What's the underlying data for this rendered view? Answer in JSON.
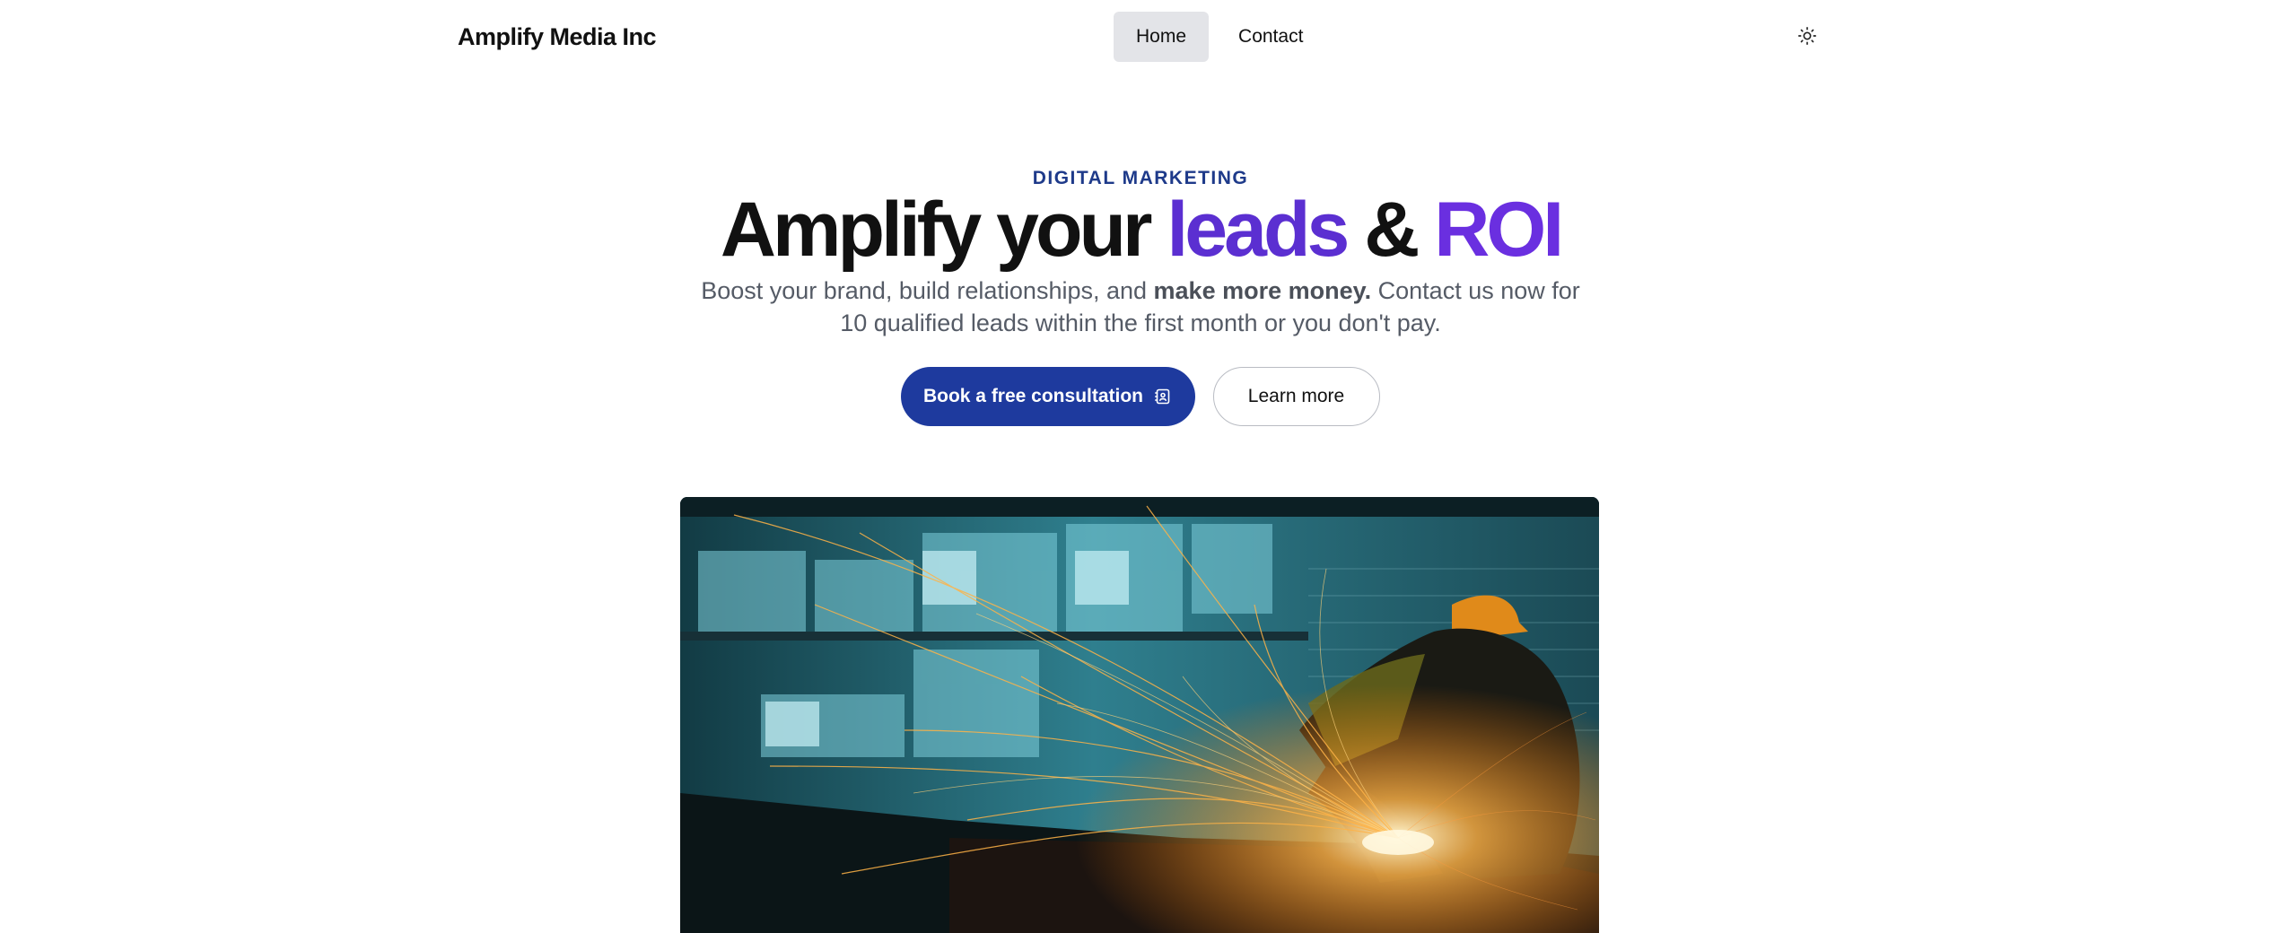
{
  "header": {
    "brand": "Amplify Media Inc",
    "nav": [
      {
        "label": "Home",
        "active": true
      },
      {
        "label": "Contact",
        "active": false
      }
    ],
    "theme_toggle_icon": "sun-icon"
  },
  "hero": {
    "eyebrow": "DIGITAL MARKETING",
    "headline": {
      "part1": "Amplify your ",
      "accent1": "leads",
      "part2": " & ",
      "accent2": "ROI"
    },
    "subtitle": {
      "before": "Boost your brand, build relationships, and ",
      "bold": "make more money.",
      "after": " Contact us now for 10 qualified leads within the first month or you don't pay."
    },
    "primary_cta": "Book a free consultation",
    "primary_cta_icon": "contact-book-icon",
    "secondary_cta": "Learn more"
  },
  "colors": {
    "eyebrow": "#1e3a8a",
    "accent_leads": "#5b2fd1",
    "accent_roi": "#6a2fe0",
    "primary_button": "#1e3a9e",
    "nav_active_bg": "#e3e4e8"
  }
}
